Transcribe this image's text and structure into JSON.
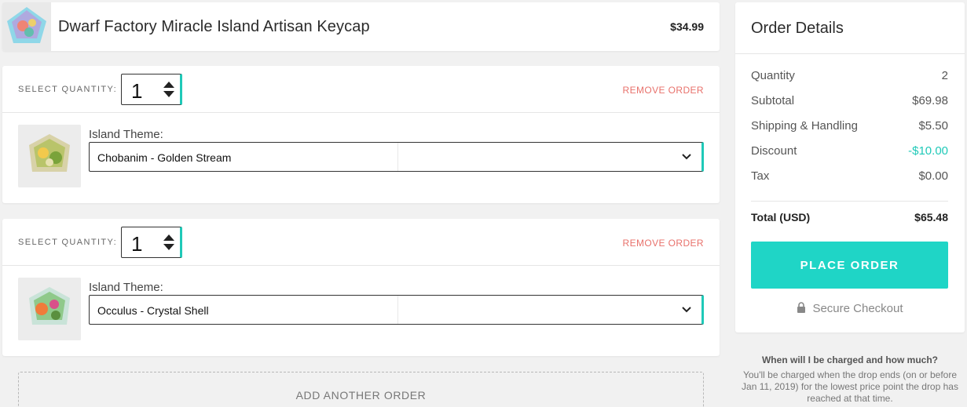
{
  "product": {
    "name": "Dwarf Factory Miracle Island Artisan Keycap",
    "price": "$34.99"
  },
  "orders": [
    {
      "quantity_label": "SELECT QUANTITY:",
      "quantity": "1",
      "remove_label": "REMOVE ORDER",
      "theme_label": "Island Theme:",
      "theme_value": "Chobanim - Golden Stream"
    },
    {
      "quantity_label": "SELECT QUANTITY:",
      "quantity": "1",
      "remove_label": "REMOVE ORDER",
      "theme_label": "Island Theme:",
      "theme_value": "Occulus - Crystal Shell"
    }
  ],
  "add_order_label": "ADD ANOTHER ORDER",
  "details": {
    "title": "Order Details",
    "rows": [
      {
        "label": "Quantity",
        "value": "2"
      },
      {
        "label": "Subtotal",
        "value": "$69.98"
      },
      {
        "label": "Shipping & Handling",
        "value": "$5.50"
      },
      {
        "label": "Discount",
        "value": "-$10.00"
      },
      {
        "label": "Tax",
        "value": "$0.00"
      }
    ],
    "total_label": "Total (USD)",
    "total_value": "$65.48",
    "place_order_label": "PLACE ORDER",
    "secure_label": "Secure Checkout"
  },
  "faq": {
    "title": "When will I be charged and how much?",
    "body": "You'll be charged when the drop ends (on or before Jan 11, 2019) for the lowest price point the drop has reached at that time."
  },
  "colors": {
    "accent": "#1fd5c6",
    "remove": "#e8716b",
    "discount": "#1fc9b8",
    "background": "#f1f1f1"
  },
  "icons": {
    "quantity_stepper": "up-down-arrows-icon",
    "select": "chevron-down-icon",
    "secure": "lock-icon"
  }
}
